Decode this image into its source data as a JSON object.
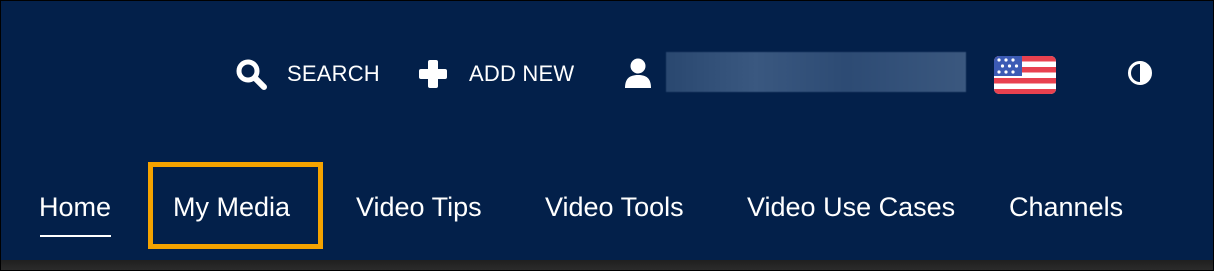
{
  "utility_bar": {
    "search_label": "SEARCH",
    "add_new_label": "ADD NEW",
    "user_name": "",
    "language_flag": "us-flag-icon",
    "contrast_icon": "contrast-icon"
  },
  "nav": {
    "items": [
      {
        "label": "Home",
        "active": true
      },
      {
        "label": "My Media",
        "highlighted": true
      },
      {
        "label": "Video Tips"
      },
      {
        "label": "Video Tools"
      },
      {
        "label": "Video Use Cases"
      },
      {
        "label": "Channels"
      }
    ]
  },
  "colors": {
    "header_background": "#03204a",
    "text": "#ffffff",
    "highlight": "#f5a300"
  }
}
